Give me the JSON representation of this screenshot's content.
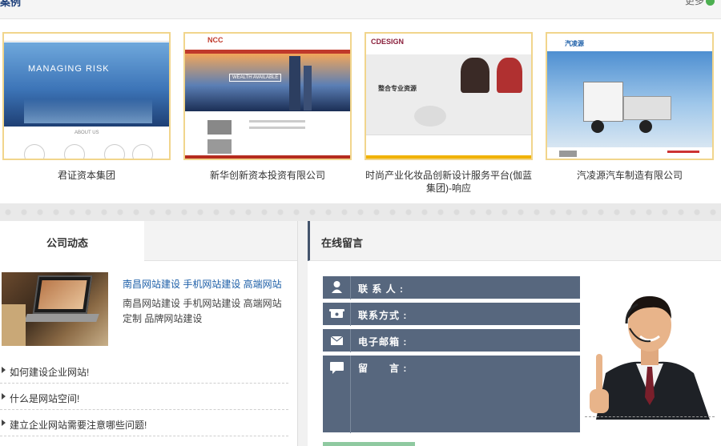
{
  "cases_section": {
    "title": "案例",
    "more_label": "更多"
  },
  "cases": [
    {
      "name": "君证资本集团",
      "thumb_text": "MANAGING RISK",
      "thumb_sub": "ABOUT US"
    },
    {
      "name": "新华创新资本投资有限公司",
      "thumb_text": "NCC",
      "thumb_sub": "WEALTH AVAILABLE"
    },
    {
      "name": "时尚产业化妆品创新设计服务平台(伽蓝集团)-响应",
      "thumb_text": "CDESIGN",
      "thumb_sub": "整合专业资源"
    },
    {
      "name": "汽凌源汽车制造有限公司",
      "thumb_text": "汽凌源",
      "thumb_sub": ""
    }
  ],
  "news": {
    "tab_label": "公司动态",
    "feature_title": "南昌网站建设 手机网站建设 高端网站",
    "feature_desc": "南昌网站建设 手机网站建设 高端网站定制 品牌网站建设",
    "items": [
      {
        "title": "如何建设企业网站!"
      },
      {
        "title": "什么是网站空间!"
      },
      {
        "title": "建立企业网站需要注意哪些问题!"
      }
    ]
  },
  "message": {
    "title": "在线留言",
    "fields": [
      {
        "label": "联 系 人 :",
        "icon": "person-icon"
      },
      {
        "label": "联系方式 :",
        "icon": "phone-icon"
      },
      {
        "label": "电子邮箱 :",
        "icon": "mail-icon"
      },
      {
        "label": "留　　言 :",
        "icon": "chat-icon"
      }
    ]
  },
  "colors": {
    "field_bg": "#57677e",
    "link_blue": "#1d5fa8",
    "thumb_border": "#f1d58c"
  }
}
